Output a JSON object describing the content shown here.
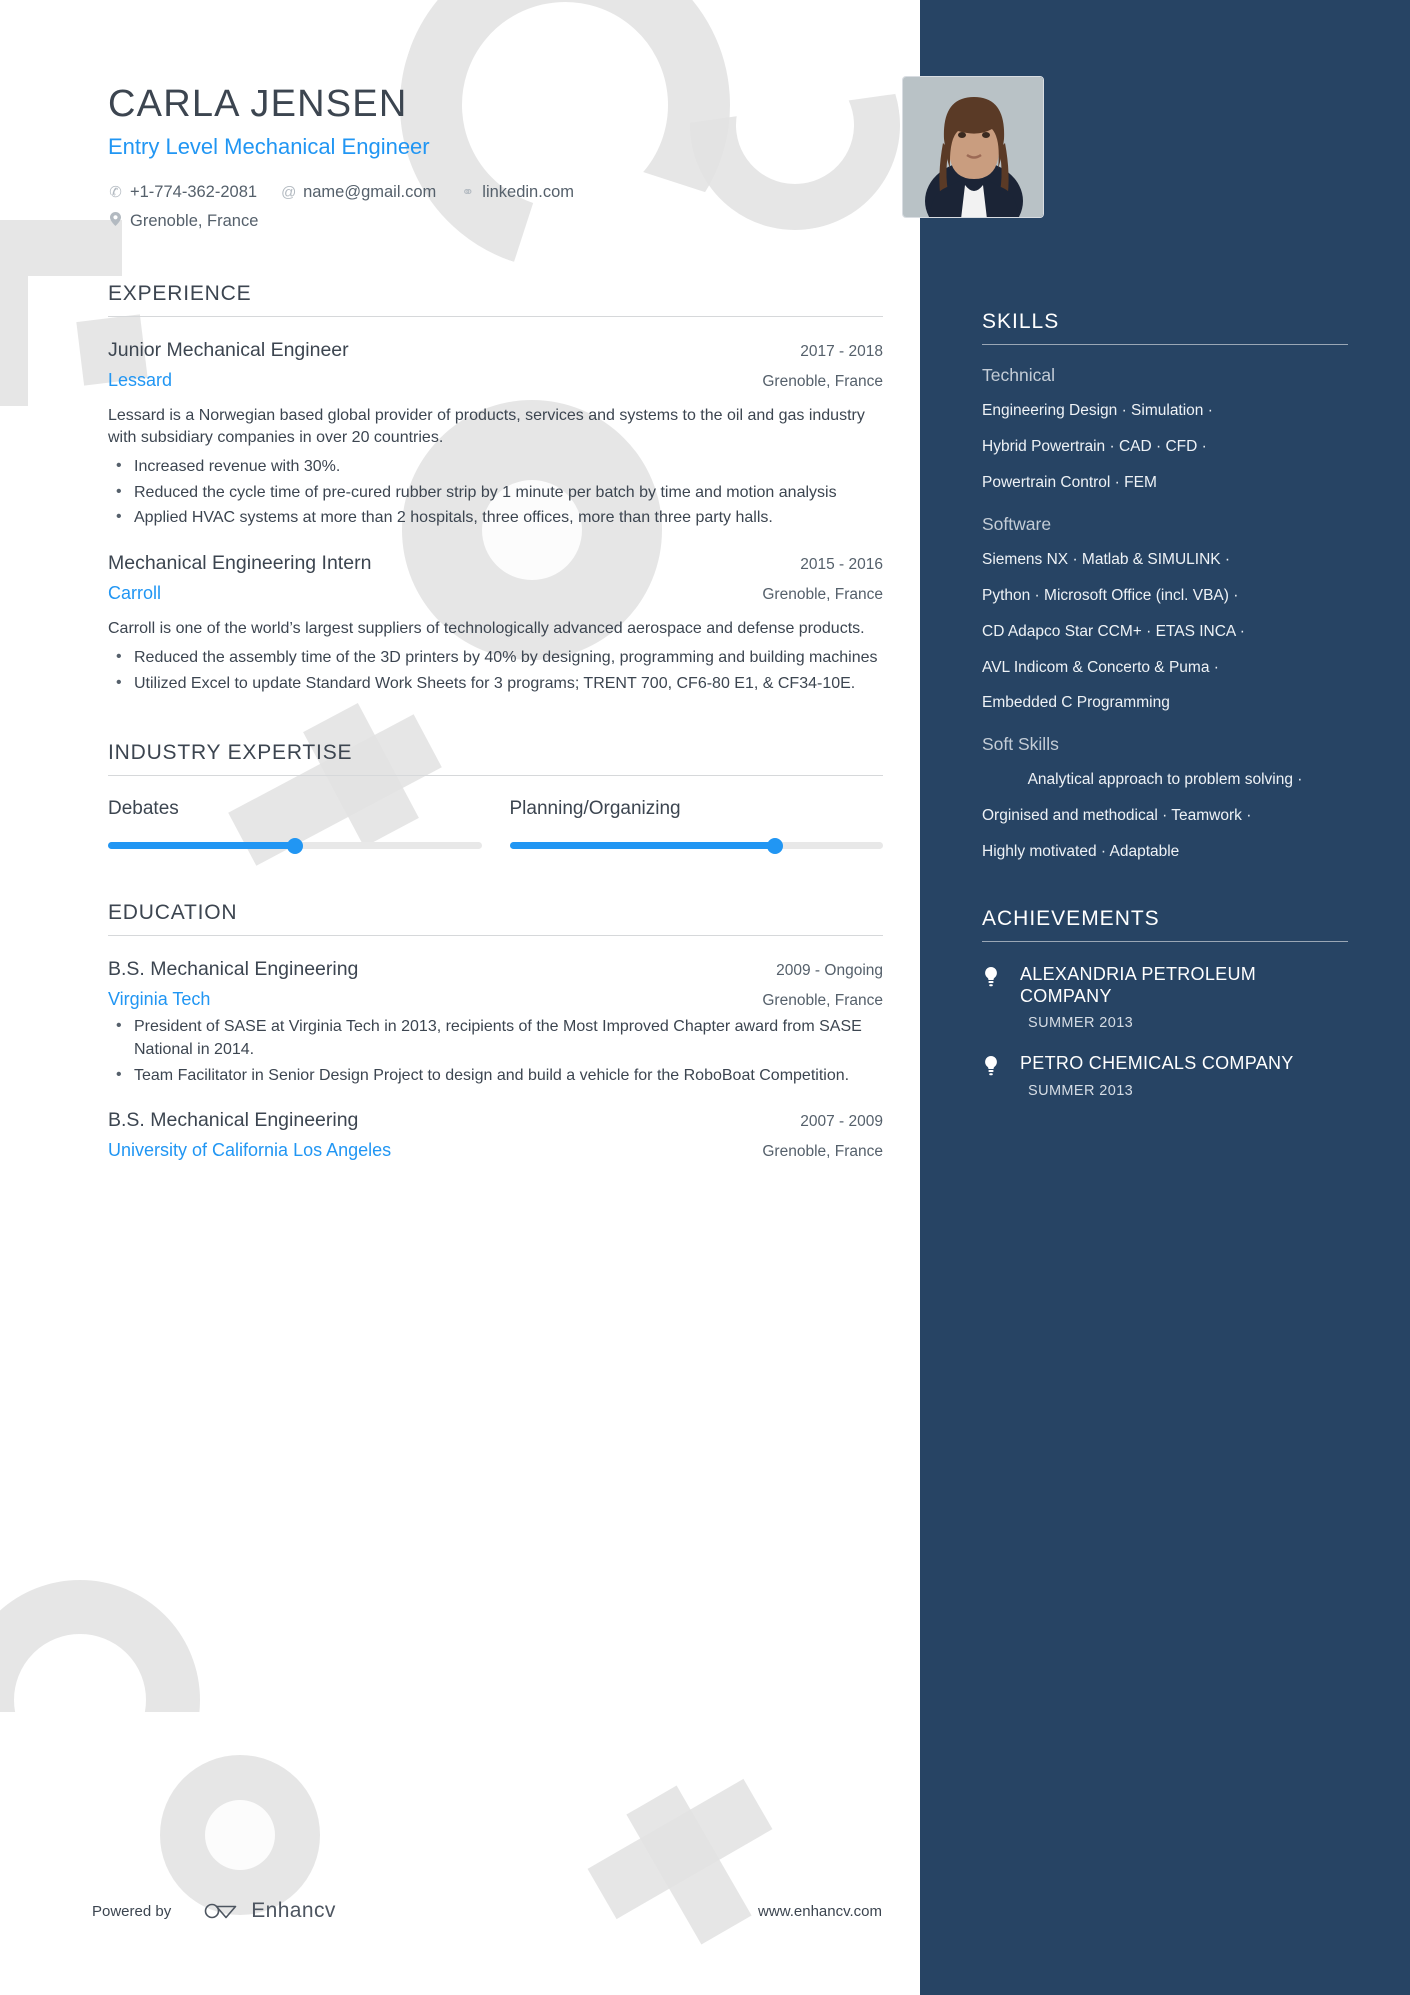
{
  "colors": {
    "accent": "#2196f3",
    "sidebar": "#274464",
    "text": "#3c4550"
  },
  "header": {
    "name": "CARLA JENSEN",
    "headline": "Entry Level Mechanical Engineer",
    "contacts": [
      {
        "icon": "phone-icon",
        "glyph": "✆",
        "text": "+1-774-362-2081"
      },
      {
        "icon": "email-icon",
        "glyph": "@",
        "text": "name@gmail.com"
      },
      {
        "icon": "link-icon",
        "glyph": "⚭",
        "text": "linkedin.com"
      }
    ],
    "location": {
      "icon": "location-pin-icon",
      "glyph": "⌕",
      "text": "Grenoble, France"
    },
    "photo_alt": "portrait photo"
  },
  "experience": {
    "title": "EXPERIENCE",
    "entries": [
      {
        "role": "Junior Mechanical Engineer",
        "date": "2017 - 2018",
        "company": "Lessard",
        "location": "Grenoble, France",
        "summary": "Lessard is a Norwegian based global provider of products, services and systems to the oil and gas industry with subsidiary companies in over 20 countries.",
        "bullets": [
          "Increased revenue with 30%.",
          "Reduced the cycle time of pre-cured rubber strip by 1 minute per batch by time and motion analysis",
          "Applied HVAC systems at more than 2 hospitals, three offices, more than three party halls."
        ]
      },
      {
        "role": "Mechanical Engineering Intern",
        "date": "2015 - 2016",
        "company": "Carroll",
        "location": "Grenoble, France",
        "summary": "Carroll is one of the world’s largest suppliers of technologically advanced aerospace and defense products.",
        "bullets": [
          "Reduced the assembly time of the 3D printers by 40% by designing, programming and building machines",
          "Utilized Excel to update Standard Work Sheets for 3 programs; TRENT 700, CF6-80 E1, & CF34-10E."
        ]
      }
    ]
  },
  "industry_expertise": {
    "title": "INDUSTRY EXPERTISE",
    "items": [
      {
        "label": "Debates",
        "value": 50
      },
      {
        "label": "Planning/Organizing",
        "value": 71
      }
    ]
  },
  "education": {
    "title": "EDUCATION",
    "entries": [
      {
        "degree": "B.S. Mechanical Engineering",
        "date": "2009 - Ongoing",
        "school": "Virginia Tech",
        "location": "Grenoble, France",
        "bullets": [
          "President of SASE at Virginia Tech in 2013, recipients of the Most Improved Chapter award from SASE National in 2014.",
          "Team Facilitator in Senior Design Project to design and build a vehicle for the RoboBoat Competition."
        ]
      },
      {
        "degree": "B.S. Mechanical Engineering",
        "date": "2007 - 2009",
        "school": "University of California Los Angeles",
        "location": "Grenoble, France",
        "bullets": []
      }
    ]
  },
  "skills": {
    "title": "SKILLS",
    "groups": [
      {
        "name": "Technical",
        "lines": [
          "Engineering Design · Simulation ·",
          "Hybrid Powertrain · CAD · CFD ·",
          "Powertrain Control · FEM"
        ]
      },
      {
        "name": "Software",
        "lines": [
          "Siemens NX · Matlab & SIMULINK ·",
          "Python · Microsoft Office (incl. VBA) ·",
          "CD Adapco Star CCM+ · ETAS INCA ·",
          "AVL Indicom & Concerto & Puma ·",
          "Embedded C Programming"
        ]
      },
      {
        "name": "Soft Skills",
        "lines": [
          "Analytical approach to problem solving ·",
          "Orginised and methodical · Teamwork ·",
          "Highly motivated · Adaptable"
        ]
      }
    ]
  },
  "achievements": {
    "title": "ACHIEVEMENTS",
    "items": [
      {
        "icon": "lightbulb-icon",
        "name": "ALEXANDRIA PETROLEUM COMPANY",
        "date": "SUMMER 2013"
      },
      {
        "icon": "lightbulb-icon",
        "name": "PETRO CHEMICALS COMPANY",
        "date": "SUMMER 2013"
      }
    ]
  },
  "footer": {
    "powered_by": "Powered by",
    "brand": "Enhancv",
    "website": "www.enhancv.com"
  }
}
